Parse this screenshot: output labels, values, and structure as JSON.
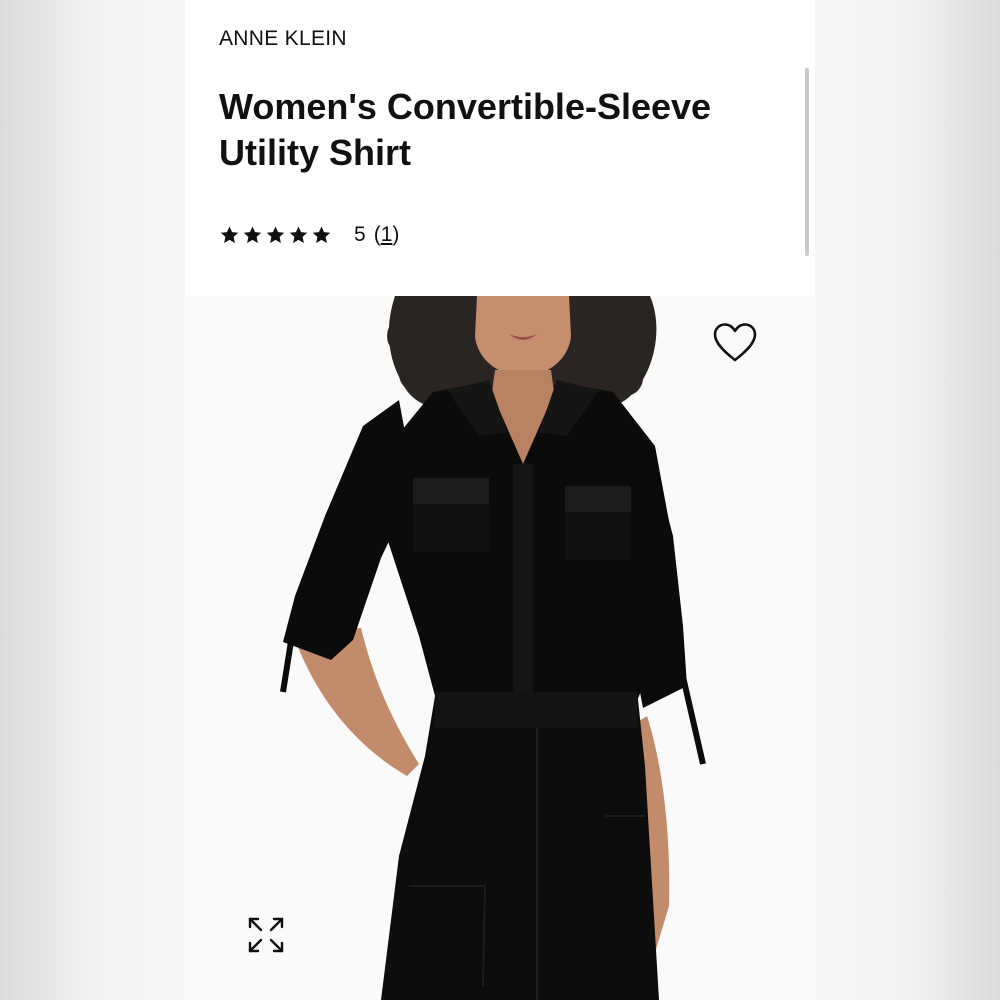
{
  "product": {
    "brand": "ANNE KLEIN",
    "title": "Women's Convertible-Sleeve Utility Shirt",
    "rating": {
      "value": "5",
      "stars_filled": 5,
      "stars_total": 5,
      "review_count": "1"
    }
  },
  "icons": {
    "star": "star-icon",
    "wishlist": "heart-outline-icon",
    "expand": "expand-arrows-icon"
  },
  "colors": {
    "text": "#111111",
    "shirt": "#0b0b0b",
    "background": "#ffffff"
  }
}
